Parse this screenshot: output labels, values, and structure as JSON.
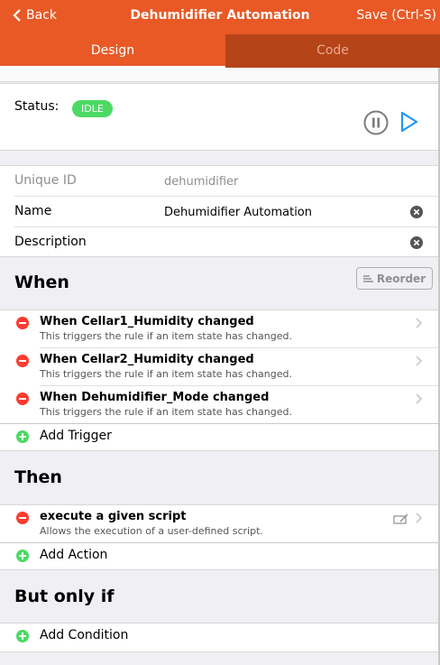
{
  "navbar": {
    "back_label": "Back",
    "title": "Dehumidifier Automation",
    "save_label": "Save (Ctrl-S)"
  },
  "tabs": [
    {
      "label": "Design",
      "active": true
    },
    {
      "label": "Code",
      "active": false
    }
  ],
  "status": {
    "label": "Status:",
    "badge": "IDLE",
    "badge_color": "#4cd964"
  },
  "fields": {
    "uid": {
      "label": "Unique ID",
      "value": "dehumidifier"
    },
    "name": {
      "label": "Name",
      "value": "Dehumidifier Automation"
    },
    "description": {
      "label": "Description",
      "value": ""
    }
  },
  "when": {
    "title": "When",
    "reorder_label": "Reorder",
    "triggers": [
      {
        "title": "When Cellar1_Humidity changed",
        "subtitle": "This triggers the rule if an item state has changed."
      },
      {
        "title": "When Cellar2_Humidity changed",
        "subtitle": "This triggers the rule if an item state has changed."
      },
      {
        "title": "When Dehumidifier_Mode changed",
        "subtitle": "This triggers the rule if an item state has changed."
      }
    ],
    "add_label": "Add Trigger"
  },
  "then": {
    "title": "Then",
    "actions": [
      {
        "title": "execute a given script",
        "subtitle": "Allows the execution of a user-defined script."
      }
    ],
    "add_label": "Add Action"
  },
  "conditions": {
    "title": "But only if",
    "add_label": "Add Condition"
  },
  "colors": {
    "accent": "#e85926",
    "tab_inactive": "#b54418",
    "remove": "#ff3b30",
    "add": "#4cd964",
    "play": "#2196f3"
  },
  "icons": [
    "chevron-left-icon",
    "pause-icon",
    "play-icon",
    "clear-icon",
    "reorder-icon",
    "remove-icon",
    "chevron-right-icon",
    "edit-script-icon",
    "add-icon"
  ]
}
